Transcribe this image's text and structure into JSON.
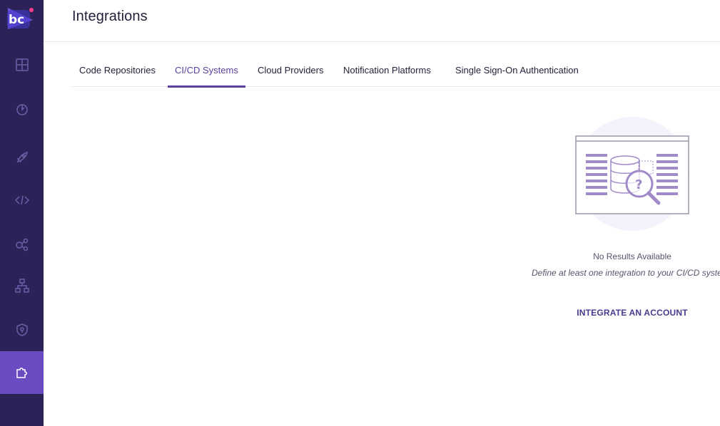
{
  "app": {
    "logo_text": "bc"
  },
  "header": {
    "title": "Integrations"
  },
  "sidebar": {
    "items": [
      {
        "icon": "dashboard-icon"
      },
      {
        "icon": "incidents-icon"
      },
      {
        "icon": "rocket-icon"
      },
      {
        "icon": "code-icon"
      },
      {
        "icon": "graph-icon"
      },
      {
        "icon": "hierarchy-icon"
      },
      {
        "icon": "shield-icon"
      },
      {
        "icon": "puzzle-icon",
        "active": true
      }
    ]
  },
  "tabs": [
    {
      "label": "Code Repositories"
    },
    {
      "label": "CI/CD Systems",
      "active": true
    },
    {
      "label": "Cloud Providers"
    },
    {
      "label": "Notification Platforms"
    },
    {
      "label": "Single Sign-On Authentication"
    }
  ],
  "empty_state": {
    "title": "No Results Available",
    "description": "Define at least one integration to your CI/CD system",
    "action_label": "INTEGRATE AN ACCOUNT"
  },
  "colors": {
    "sidebar_bg": "#2b2358",
    "accent": "#5a3f9e",
    "active_nav": "#6a4bc1"
  }
}
